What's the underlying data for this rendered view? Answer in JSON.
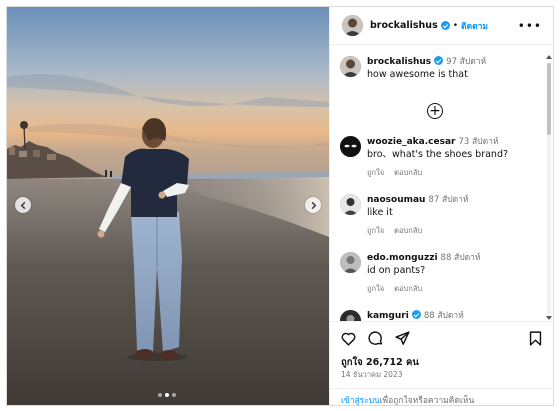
{
  "post": {
    "author": "brockalishus",
    "follow_label": "ติดตาม",
    "separator": "•",
    "more_label": "•••"
  },
  "caption": {
    "username": "brockalishus",
    "time": "97 สัปดาห์",
    "text": "how awesome is that"
  },
  "comments": [
    {
      "username": "woozie_aka.cesar",
      "time": "73 สัปดาห์",
      "text": "bro、what's the shoes brand?",
      "like": "ถูกใจ",
      "reply": "ตอบกลับ"
    },
    {
      "username": "naosoumau",
      "time": "87 สัปดาห์",
      "text": "like it",
      "like": "ถูกใจ",
      "reply": "ตอบกลับ"
    },
    {
      "username": "edo.monguzzi",
      "time": "88 สัปดาห์",
      "text": "id on pants?",
      "like": "ถูกใจ",
      "reply": "ตอบกลับ"
    },
    {
      "username": "kamguri",
      "time": "88 สัปดาห์",
      "text": "",
      "like": "",
      "reply": ""
    }
  ],
  "more_replies_symbol": "+",
  "likes_text": "ถูกใจ 26,712 คน",
  "date_text": "14 ธันวาคม 2023",
  "login": {
    "link": "เข้าสู่ระบบ",
    "rest": "เพื่อถูกใจหรือความคิดเห็น"
  },
  "carousel": {
    "current": 2,
    "total": 3
  },
  "icons": [
    "heart-icon",
    "comment-icon",
    "share-icon",
    "bookmark-icon",
    "chevron-left-icon",
    "chevron-right-icon"
  ],
  "colors": {
    "accent": "#0095f6",
    "verified": "#1d9bf0",
    "muted": "#737373"
  }
}
